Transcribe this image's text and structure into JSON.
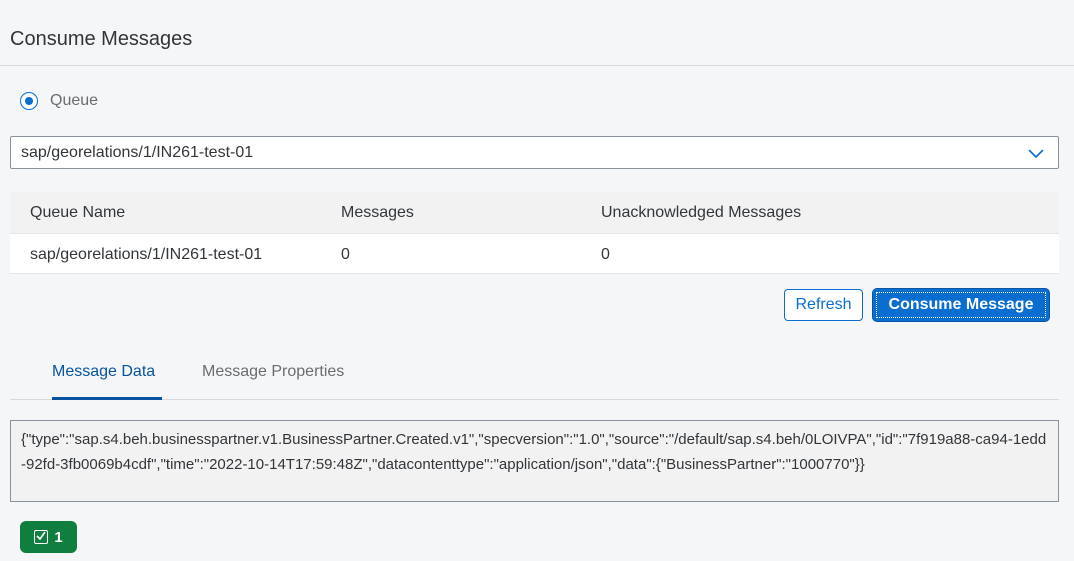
{
  "header": {
    "title": "Consume Messages"
  },
  "source_type": {
    "selected": "Queue",
    "label": "Queue"
  },
  "queue_select": {
    "value": "sap/georelations/1/IN261-test-01"
  },
  "queue_table": {
    "columns": [
      "Queue Name",
      "Messages",
      "Unacknowledged Messages"
    ],
    "rows": [
      {
        "queue_name": "sap/georelations/1/IN261-test-01",
        "messages": "0",
        "unacknowledged": "0"
      }
    ]
  },
  "actions": {
    "refresh_label": "Refresh",
    "consume_label": "Consume Message"
  },
  "tabs": [
    {
      "label": "Message Data",
      "active": true
    },
    {
      "label": "Message Properties",
      "active": false
    }
  ],
  "message_data": "{\"type\":\"sap.s4.beh.businesspartner.v1.BusinessPartner.Created.v1\",\"specversion\":\"1.0\",\"source\":\"/default/sap.s4.beh/0LOIVPA\",\"id\":\"7f919a88-ca94-1edd-92fd-3fb0069b4cdf\",\"time\":\"2022-10-14T17:59:48Z\",\"datacontenttype\":\"application/json\",\"data\":{\"BusinessPartner\":\"1000770\"}}",
  "status_badge": {
    "icon": "checkbox-checked-icon",
    "count": "1",
    "color": "#107e3e"
  },
  "colors": {
    "accent": "#0a6ed1",
    "success": "#107e3e"
  }
}
